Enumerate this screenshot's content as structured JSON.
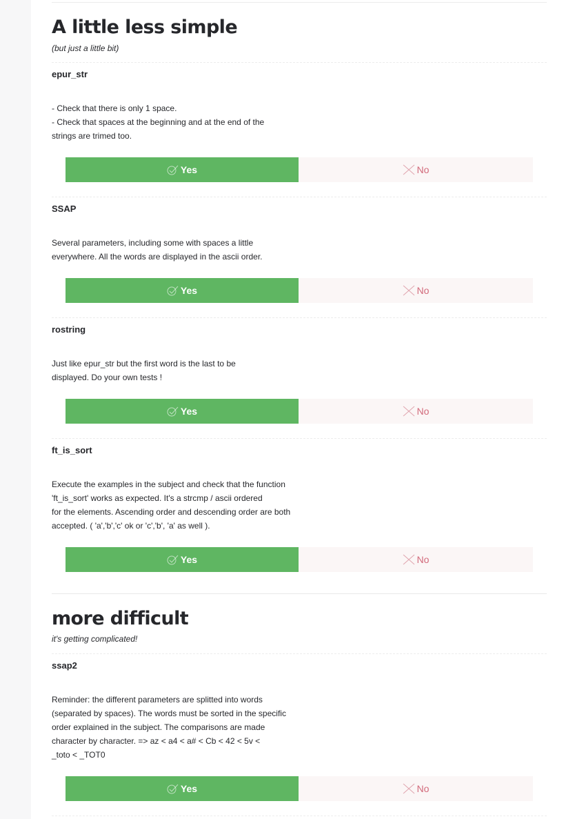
{
  "sections": [
    {
      "title": "A little less simple",
      "subtitle": "(but just a little bit)",
      "items": [
        {
          "title": "epur_str",
          "desc": [
            "- Check that there is only 1 space.",
            "- Check that spaces at the beginning and at the end of the",
            "strings are trimed too."
          ],
          "yes": "Yes",
          "no": "No"
        },
        {
          "title": "SSAP",
          "desc": [
            "Several parameters, including some with spaces a little",
            "everywhere. All the words are displayed in the ascii order."
          ],
          "yes": "Yes",
          "no": "No"
        },
        {
          "title": "rostring",
          "desc": [
            "Just like epur_str but the first word is the last to be",
            "displayed. Do your own tests !"
          ],
          "yes": "Yes",
          "no": "No"
        },
        {
          "title": "ft_is_sort",
          "desc": [
            "Execute the examples in the subject and check that the function",
            "'ft_is_sort' works as expected. It's a strcmp / ascii ordered",
            "for the elements. Ascending order and descending order are both",
            "accepted. ( 'a','b','c' ok or 'c','b', 'a' as well )."
          ],
          "yes": "Yes",
          "no": "No"
        }
      ]
    },
    {
      "title": "more difficult",
      "subtitle": "it's getting complicated!",
      "items": [
        {
          "title": "ssap2",
          "desc": [
            "Reminder: the different parameters are splitted into words",
            "(separated by spaces). The words must be sorted in the specific",
            "order explained in the subject. The comparisons are made",
            "character by character. => az < a4 < a# < Cb < 42 < 5v <",
            "_toto < _TOT0"
          ],
          "yes": "Yes",
          "no": "No"
        }
      ]
    }
  ],
  "colors": {
    "yes_bg": "#5fb662",
    "no_bg": "#fbf6f6",
    "no_text": "#d26a7b"
  },
  "icons": {
    "yes": "check-circle-icon",
    "no": "x-icon"
  }
}
